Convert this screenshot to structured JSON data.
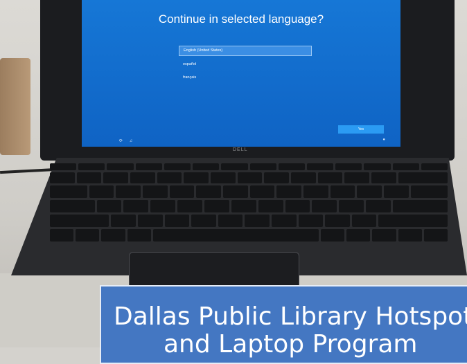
{
  "oobe": {
    "title": "Continue in selected language?",
    "languages": [
      "English (United States)",
      "español",
      "français"
    ],
    "selected_index": 0,
    "next_label": "Yes"
  },
  "laptop": {
    "brand": "DELL"
  },
  "banner": {
    "line1": "Dallas Public Library Hotspot",
    "line2": "and Laptop Program"
  },
  "colors": {
    "screen": "#0f63c4",
    "banner": "#4477c2"
  }
}
